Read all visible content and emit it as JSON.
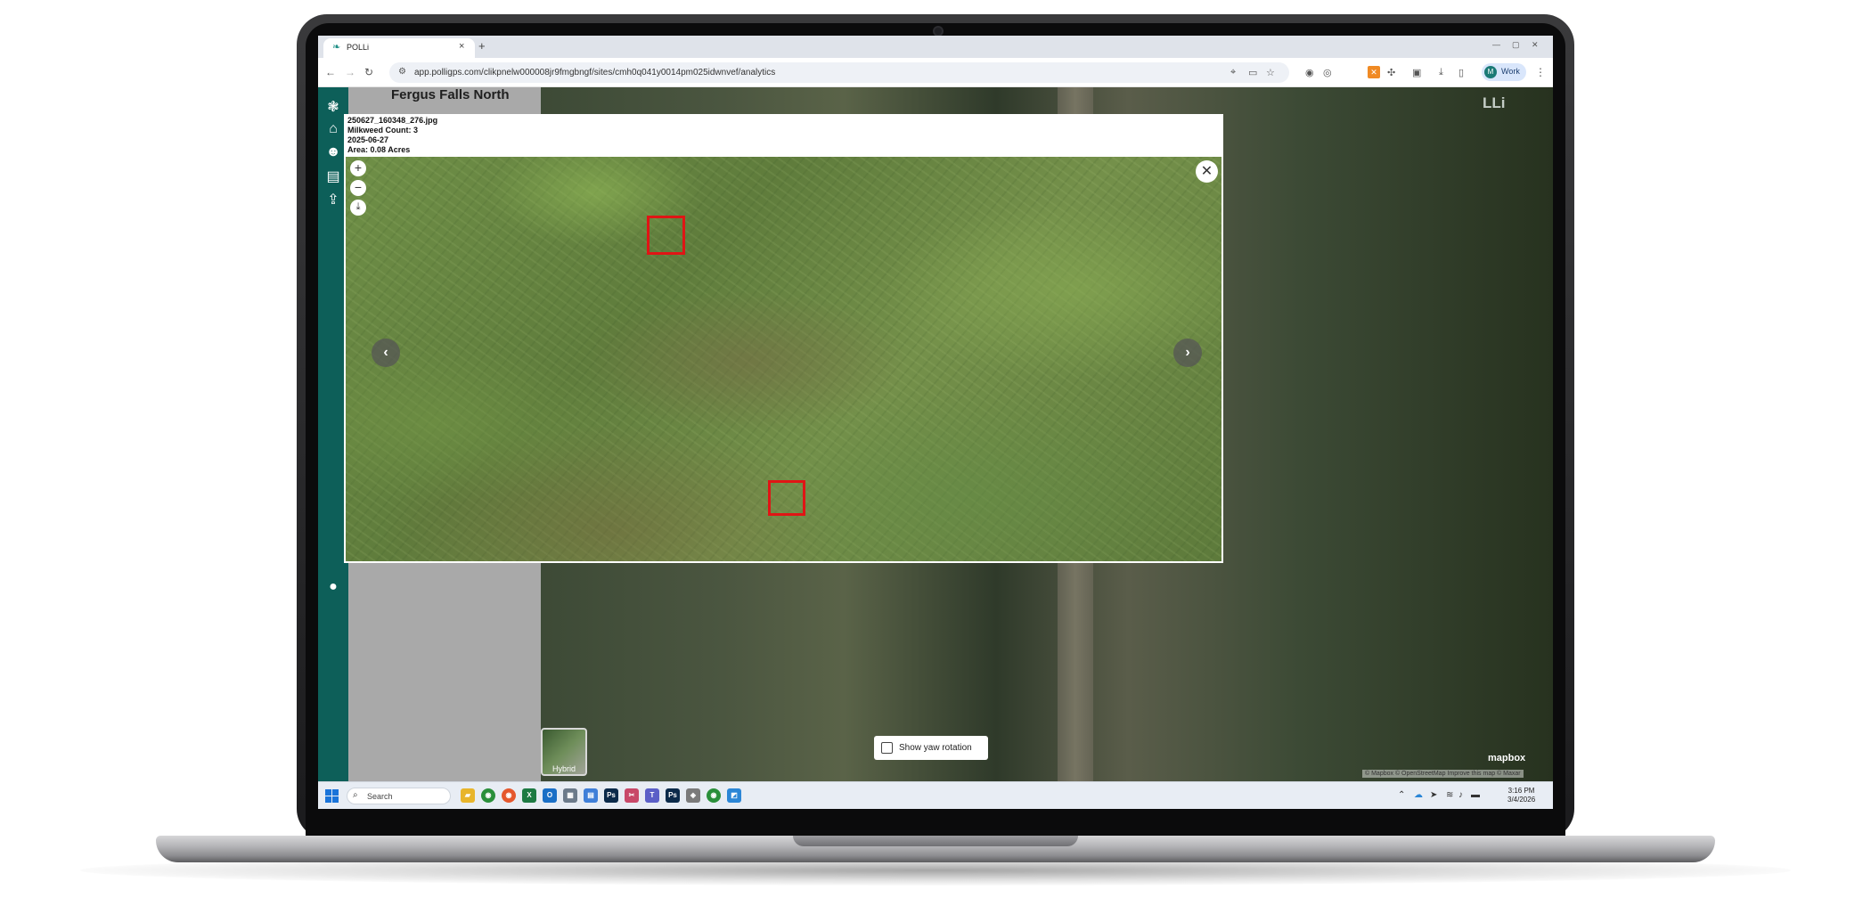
{
  "browser": {
    "tab_title": "POLLi",
    "url": "app.polligps.com/clikpnelw000008jr9fmgbngf/sites/cmh0q041y0014pm025idwnvef/analytics",
    "profile_label": "Work",
    "profile_initial": "M",
    "new_tab_glyph": "+",
    "tab_close_glyph": "×"
  },
  "site": {
    "title": "Fergus Falls North",
    "map_logo": "LLi"
  },
  "viewer": {
    "filename": "250627_160348_276.jpg",
    "milkweed_count": "Milkweed Count: 3",
    "date": "2025-06-27",
    "area": "Area: 0.08 Acres",
    "zoom_in": "+",
    "zoom_out": "−",
    "download": "⤓",
    "close": "✕",
    "prev": "‹",
    "next": "›"
  },
  "map": {
    "hybrid_label": "Hybrid",
    "yaw_label": "Show yaw rotation",
    "mapbox_logo": "mapbox",
    "attribution": "© Mapbox © OpenStreetMap  Improve this map © Maxar"
  },
  "taskbar": {
    "search_placeholder": "Search",
    "time": "3:16 PM",
    "date": "3/4/2026"
  },
  "colors": {
    "sidebar": "#0d5f59",
    "detection_box": "#e01515",
    "brand_teal": "#1f8f86"
  },
  "icons": {
    "nav": [
      "logo-icon",
      "home-icon",
      "users-icon",
      "document-icon",
      "upload-icon",
      "account-icon"
    ]
  }
}
